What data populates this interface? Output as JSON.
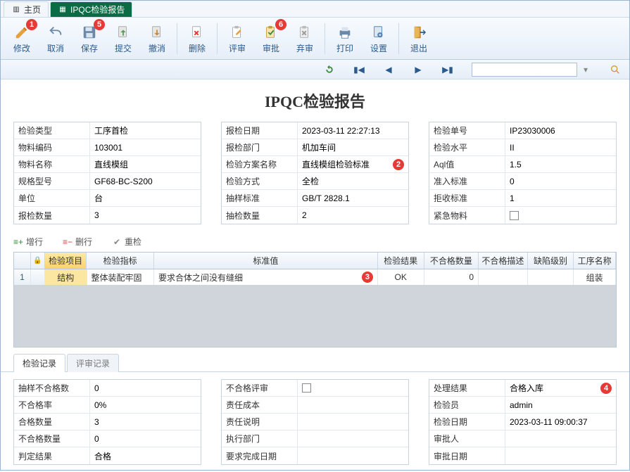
{
  "tabs": {
    "home": "主页",
    "report_tab": "IPQC检验报告"
  },
  "toolbar": {
    "modify": "修改",
    "cancel": "取消",
    "save": "保存",
    "submit": "提交",
    "revoke": "撤消",
    "delete": "删除",
    "review": "评审",
    "approve": "审批",
    "discard": "弃审",
    "print": "打印",
    "settings": "设置",
    "exit": "退出"
  },
  "toolbar_badges": {
    "modify": "1",
    "save": "5",
    "approve": "6"
  },
  "title": "IPQC检验报告",
  "left_panel": {
    "check_type_label": "检验类型",
    "check_type": "工序首检",
    "mat_code_label": "物料编码",
    "mat_code": "103001",
    "mat_name_label": "物料名称",
    "mat_name": "直线模组",
    "spec_label": "规格型号",
    "spec": "GF68-BC-S200",
    "unit_label": "单位",
    "unit": "台",
    "qty_label": "报检数量",
    "qty": "3"
  },
  "mid_panel": {
    "date_label": "报检日期",
    "date": "2023-03-11 22:27:13",
    "dept_label": "报检部门",
    "dept": "机加车间",
    "plan_label": "检验方案名称",
    "plan": "直线模组检验标准",
    "mode_label": "检验方式",
    "mode": "全检",
    "std_label": "抽样标准",
    "std": "GB/T 2828.1",
    "sqty_label": "抽检数量",
    "sqty": "2"
  },
  "mid_badges": {
    "plan": "2"
  },
  "right_panel": {
    "no_label": "检验单号",
    "no": "IP23030006",
    "level_label": "检验水平",
    "level": "II",
    "aql_label": "Aql值",
    "aql": "1.5",
    "accept_label": "准入标准",
    "accept": "0",
    "reject_label": "拒收标准",
    "reject": "1",
    "urgent_label": "紧急物料"
  },
  "row_actions": {
    "add": "增行",
    "del": "删行",
    "reset": "重检"
  },
  "grid": {
    "headers": {
      "item": "检验项目",
      "metric": "检验指标",
      "std": "标准值",
      "result": "检验结果",
      "ngqty": "不合格数量",
      "ngdesc": "不合格描述",
      "defect": "缺陷级别",
      "proc": "工序名称"
    },
    "row1": {
      "idx": "1",
      "item": "结构",
      "metric": "整体装配牢固",
      "std": "要求合体之间没有缝细",
      "result": "OK",
      "ngqty": "0",
      "ngdesc": "",
      "defect": "",
      "proc": "组装"
    },
    "row_badge": "3"
  },
  "lower_tabs": {
    "records": "检验记录",
    "reviews": "评审记录"
  },
  "bl": {
    "sng_label": "抽样不合格数",
    "sng": "0",
    "rate_label": "不合格率",
    "rate": "0%",
    "okqty_label": "合格数量",
    "okqty": "3",
    "ngqty_label": "不合格数量",
    "ngqty": "0",
    "judge_label": "判定结果",
    "judge": "合格"
  },
  "bm": {
    "review_label": "不合格评审",
    "cost_label": "责任成本",
    "cost": "",
    "desc_label": "责任说明",
    "desc": "",
    "dept_label": "执行部门",
    "dept": "",
    "due_label": "要求完成日期",
    "due": ""
  },
  "br": {
    "result_label": "处理结果",
    "result": "合格入库",
    "inspector_label": "检验员",
    "inspector": "admin",
    "date_label": "检验日期",
    "date": "2023-03-11 09:00:37",
    "approver_label": "审批人",
    "approver": "",
    "appdate_label": "审批日期",
    "appdate": ""
  },
  "br_badges": {
    "result": "4"
  }
}
